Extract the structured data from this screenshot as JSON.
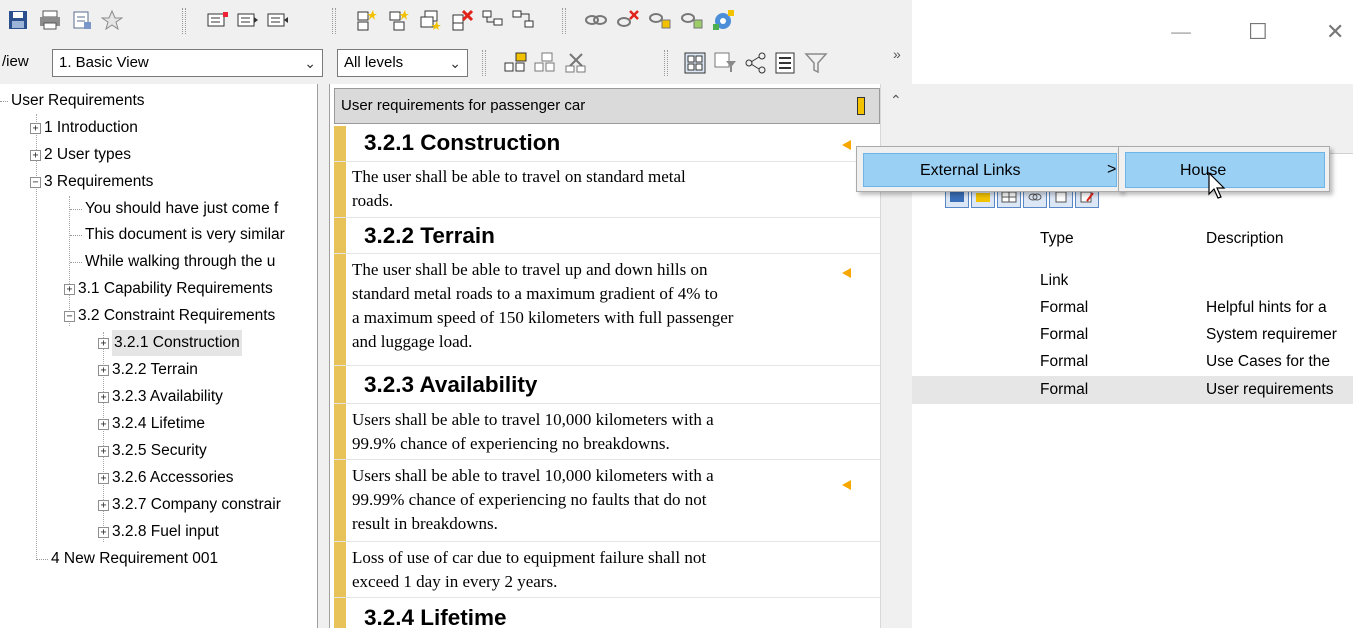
{
  "window": {
    "minimize": "—",
    "maximize": "☐",
    "close": "✕"
  },
  "toolbar": {
    "view_label": "/iew",
    "view_value": "1. Basic View",
    "level_value": "All levels",
    "more": "»",
    "icons": [
      "save-icon",
      "print-icon",
      "format-icon",
      "star-icon",
      "insert-below-icon",
      "insert-child-icon",
      "insert-after-icon",
      "new-object-icon",
      "new-sibling-icon",
      "copy-object-icon",
      "delete-object-icon",
      "link-tree-icon",
      "hierarchy-icon",
      "link-icon",
      "delete-link-icon",
      "link-outgoing-icon",
      "link-incoming-icon",
      "link-settings-icon"
    ],
    "icons2": [
      "promote-icon",
      "demote-icon",
      "cut-icon",
      "split-view-icon",
      "filter-view-icon",
      "share-icon",
      "table-icon",
      "filter-icon"
    ]
  },
  "tree": {
    "root": "User Requirements",
    "items": [
      {
        "label": "1 Introduction",
        "box": "+"
      },
      {
        "label": "2 User types",
        "box": "+"
      },
      {
        "label": "3 Requirements",
        "box": "−"
      },
      {
        "label": "You should have just come f"
      },
      {
        "label": "This document is very similar"
      },
      {
        "label": "While walking through the u"
      },
      {
        "label": "3.1 Capability Requirements",
        "box": "+"
      },
      {
        "label": "3.2 Constraint Requirements",
        "box": "−"
      },
      {
        "label": "3.2.1 Construction",
        "box": "+",
        "selected": true
      },
      {
        "label": "3.2.2 Terrain",
        "box": "+"
      },
      {
        "label": "3.2.3 Availability",
        "box": "+"
      },
      {
        "label": "3.2.4 Lifetime",
        "box": "+"
      },
      {
        "label": "3.2.5 Security",
        "box": "+"
      },
      {
        "label": "3.2.6 Accessories",
        "box": "+"
      },
      {
        "label": "3.2.7 Company constrair",
        "box": "+"
      },
      {
        "label": "3.2.8 Fuel input",
        "box": "+"
      },
      {
        "label": "4 New Requirement 001"
      }
    ]
  },
  "doc": {
    "header": "User requirements for passenger car",
    "rows": [
      {
        "kind": "heading",
        "text": "3.2.1 Construction",
        "marker": true
      },
      {
        "kind": "text",
        "text": "The user shall be able to travel on standard metal\nroads."
      },
      {
        "kind": "heading",
        "text": "3.2.2 Terrain"
      },
      {
        "kind": "text",
        "text": "The user shall be able to travel up and down hills on\nstandard metal roads to a maximum gradient of  4% to\na maximum speed of 150 kilometers with full passenger\nand luggage load.",
        "marker": true
      },
      {
        "kind": "heading",
        "text": "3.2.3 Availability"
      },
      {
        "kind": "text",
        "text": "Users shall be able to travel 10,000 kilometers with a\n99.9% chance of experiencing no breakdowns."
      },
      {
        "kind": "text",
        "text": "Users shall be able to travel 10,000 kilometers with a\n99.99% chance of experiencing no faults that do not\nresult in breakdowns.",
        "marker": true
      },
      {
        "kind": "text",
        "text": "Loss of use of car due to equipment failure shall not\nexceed 1 day in every 2 years."
      },
      {
        "kind": "heading",
        "text": "3.2.4 Lifetime"
      }
    ]
  },
  "links_table": {
    "columns": [
      "Type",
      "Description"
    ],
    "rows": [
      {
        "type": "Link",
        "description": ""
      },
      {
        "type": "Formal",
        "description": "Helpful hints for a"
      },
      {
        "type": "Formal",
        "description": "System requiremer"
      },
      {
        "type": "Formal",
        "description": "Use Cases for the"
      },
      {
        "type": "Formal",
        "description": "User requirements",
        "selected": true
      }
    ]
  },
  "context_menu": {
    "item": "External Links",
    "arrow": ">",
    "submenu_item": "House"
  },
  "colors": {
    "accent_bar": "#e8c35a",
    "menu_highlight": "#9bd0f5",
    "marker": "#f6a800"
  }
}
